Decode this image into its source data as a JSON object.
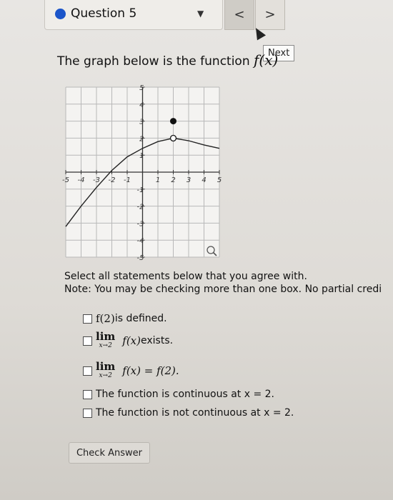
{
  "header": {
    "question_label": "Question 5",
    "dropdown_icon": "caret-down-icon",
    "prev_symbol": "<",
    "next_symbol": ">",
    "next_tooltip": "Next"
  },
  "prompt": {
    "text": "The graph below is the function ",
    "func": "f(x)"
  },
  "graph": {
    "x_ticks": [
      "-5",
      "-4",
      "-3",
      "-2",
      "-1",
      "1",
      "2",
      "3",
      "4",
      "5"
    ],
    "y_ticks": [
      "5",
      "4",
      "3",
      "2",
      "1",
      "-1",
      "-2",
      "-3",
      "-4",
      "-5"
    ],
    "xlim": [
      -5,
      5
    ],
    "ylim": [
      -5,
      5
    ],
    "curve_left": [
      [
        -5,
        -3.2
      ],
      [
        -4,
        -2.0
      ],
      [
        -3,
        -0.9
      ],
      [
        -2,
        0.1
      ],
      [
        -1,
        0.9
      ],
      [
        0,
        1.4
      ],
      [
        1,
        1.8
      ],
      [
        2,
        2
      ]
    ],
    "curve_right": [
      [
        2,
        2
      ],
      [
        3,
        1.85
      ],
      [
        4,
        1.6
      ],
      [
        5,
        1.4
      ]
    ],
    "open_point": [
      2,
      2
    ],
    "closed_point": [
      2,
      3
    ],
    "magnify_icon": "magnify-icon"
  },
  "instructions": {
    "line1": "Select all statements below that you agree with.",
    "line2": "Note: You may be checking more than one box. No partial credi"
  },
  "options": [
    {
      "math": "f(2)",
      "text": " is defined."
    },
    {
      "lim": "lim",
      "sub": "x→2",
      "math": "f(x)",
      "text": " exists."
    },
    {
      "lim": "lim",
      "sub": "x→2",
      "math": "f(x) = f(2).",
      "text": ""
    },
    {
      "math": "",
      "text": "The function is continuous at x = 2."
    },
    {
      "math": "",
      "text": "The function is not continuous at x = 2."
    }
  ],
  "check_answer_label": "Check Answer"
}
